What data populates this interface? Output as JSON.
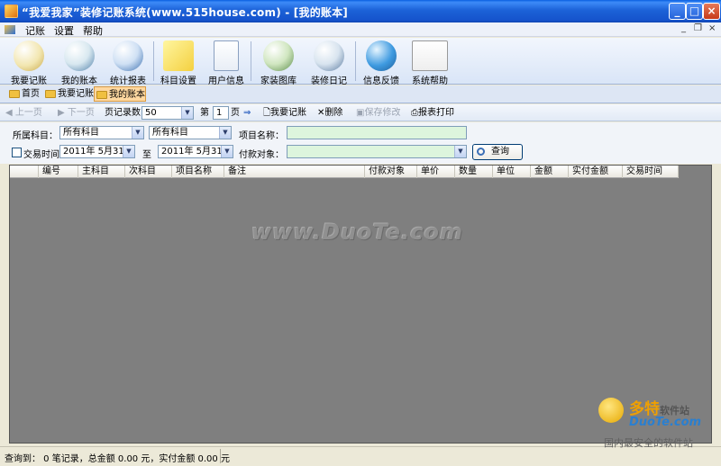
{
  "window": {
    "title": "“我爱我家”装修记账系统(www.515house.com) - [我的账本]",
    "minimize": "_",
    "maximize": "□",
    "close": "×"
  },
  "menu": {
    "items": [
      "记账",
      "设置",
      "帮助"
    ],
    "mdi_min": "_",
    "mdi_restore": "❐",
    "mdi_close": "×"
  },
  "toolbar": {
    "buttons": [
      "我要记账",
      "我的账本",
      "统计报表",
      "科目设置",
      "用户信息",
      "家装图库",
      "装修日记",
      "信息反馈",
      "系统帮助"
    ]
  },
  "tabs": [
    "首页",
    "我要记账",
    "我的账本"
  ],
  "pager": {
    "first": "上一页",
    "next": "下一页",
    "page_size_label": "页记录数",
    "page_size_value": "50",
    "page_prefix": "第",
    "page_value": "1",
    "page_suffix": "页",
    "go_icon": "⇒",
    "add": "我要记账",
    "delete": "删除",
    "save": "保存修改",
    "print": "报表打印"
  },
  "filter": {
    "subject_label": "所属科目：",
    "main_subject": "所有科目",
    "sub_subject": "所有科目",
    "item_name_label": "项目名称：",
    "item_name_value": "",
    "trade_time_label": "交易时间",
    "date_from": "2011年 5月31日",
    "to_label": "至",
    "date_to": "2011年 5月31日",
    "payee_label": "付款对象：",
    "payee_value": "",
    "query_button": "查询"
  },
  "grid": {
    "columns": [
      "编号",
      "主科目",
      "次科目",
      "项目名称",
      "备注",
      "付款对象",
      "单价",
      "数量",
      "单位",
      "金额",
      "实付金额",
      "交易时间"
    ],
    "watermark": "www.DuoTe.com"
  },
  "status": {
    "text": "查询到： 0 笔记录，总金额 0.00 元，实付金额 0.00 元"
  },
  "logo": {
    "brand": "多特",
    "brand_suffix": "软件站",
    "site": "DuoTe.com",
    "slogan": "国内最安全的软件站"
  },
  "colors": {
    "titlebar": "#1C62D8",
    "grid_bg": "#7F7F7F",
    "active_tab": "#FFD8A0",
    "input_green": "#DDF5DD"
  }
}
